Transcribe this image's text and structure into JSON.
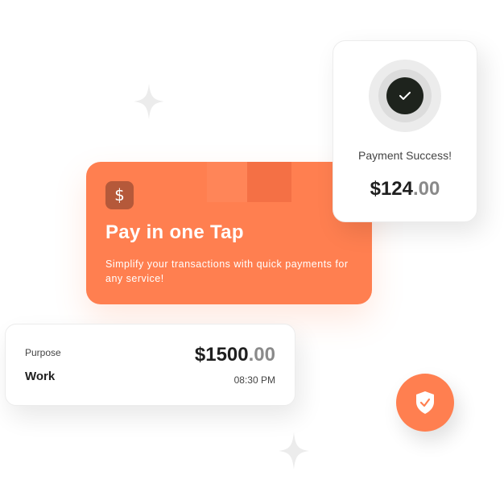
{
  "promo": {
    "icon": "dollar-icon",
    "icon_glyph": "$",
    "title": "Pay in one Tap",
    "description": "Simplify your transactions with quick payments for any service!"
  },
  "success": {
    "icon": "check-icon",
    "label": "Payment Success!",
    "amount_main": "$124",
    "amount_cents": ".00"
  },
  "purpose": {
    "label": "Purpose",
    "value": "Work",
    "amount_main": "$1500",
    "amount_cents": ".00",
    "time": "08:30 PM"
  },
  "shield": {
    "icon": "shield-check-icon"
  },
  "decorations": {
    "sparkle_icon": "sparkle-icon"
  },
  "colors": {
    "accent": "#ff7f50",
    "dark": "#1e231d",
    "muted": "#8a8a8a"
  }
}
